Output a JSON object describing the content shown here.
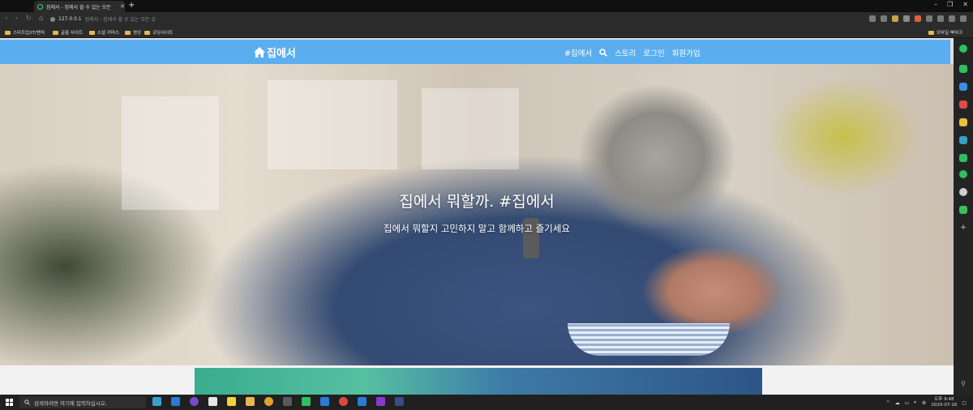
{
  "browser": {
    "tab_title": "집에서 - 집에서 할 수 있는 모든",
    "new_tab": "+",
    "url_host": "127.0.0.1",
    "url_rest": "집에서 - 집에서 할 수 있는 모든 것",
    "bookmarks": [
      "스타트업/IT/벤처",
      "글꼴 사이트",
      "소셜 커머스",
      "영상",
      "코딩사이트"
    ],
    "bookmark_right": "모바일 북마크"
  },
  "site": {
    "brand": "집에서",
    "nav": {
      "hashtag": "#집에서",
      "story": "스토리",
      "login": "로그인",
      "signup": "회원가입"
    },
    "hero": {
      "title": "집에서 뭐할까. #집에서",
      "subtitle": "집에서 뭐할지 고민하지 말고 함께하고 즐기세요"
    }
  },
  "taskbar": {
    "search_placeholder": "검색하려면 여기에 입력하십시오.",
    "time": "오후 9:48",
    "date": "2020-07-16"
  },
  "colors": {
    "navbar": "#5aaef0",
    "browser_dark": "#2b2b2b",
    "taskbar": "#202020"
  }
}
